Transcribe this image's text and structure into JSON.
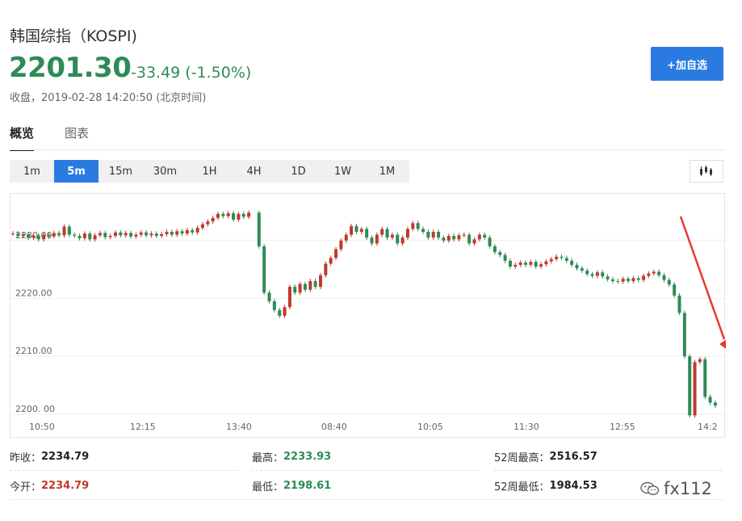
{
  "header": {
    "title": "韩国综指（KOSPI)",
    "price": "2201.30",
    "change": "-33.49 (-1.50%)",
    "status": "收盘，2019-02-28 14:20:50 (北京时间)",
    "add_button": "+加自选"
  },
  "tabs": [
    {
      "label": "概览",
      "active": true
    },
    {
      "label": "图表",
      "active": false
    }
  ],
  "intervals": [
    {
      "label": "1m",
      "active": false
    },
    {
      "label": "5m",
      "active": true
    },
    {
      "label": "15m",
      "active": false
    },
    {
      "label": "30m",
      "active": false
    },
    {
      "label": "1H",
      "active": false
    },
    {
      "label": "4H",
      "active": false
    },
    {
      "label": "1D",
      "active": false
    },
    {
      "label": "1W",
      "active": false
    },
    {
      "label": "1M",
      "active": false
    }
  ],
  "chart_type_icon": "candlestick-icon",
  "colors": {
    "up": "#c0392b",
    "down": "#2e8b57",
    "accent": "#2a7ae2",
    "arrow": "#e53935"
  },
  "chart_data": {
    "type": "candlestick",
    "y_ticks": [
      "2200. 00",
      "2210.00",
      "2220.00",
      "2230.00"
    ],
    "y_tick_values": [
      2200,
      2210,
      2220,
      2230
    ],
    "x_ticks": [
      "10:50",
      "12:15",
      "13:40",
      "08:40",
      "10:05",
      "11:30",
      "12:55",
      "14:2"
    ],
    "ylim": [
      2199,
      2237.5
    ],
    "grid": true,
    "annotation": "red arrow pointing at final drop",
    "sessions": [
      [
        2231.2,
        2230.8,
        2231.1,
        2230.5,
        2230.9,
        2230.2,
        2231.0,
        2230.7,
        2231.3,
        2230.9,
        2232.4,
        2231.0,
        2230.8,
        2230.4,
        2231.2,
        2230.2,
        2230.9,
        2231.3,
        2230.6,
        2230.8,
        2231.4,
        2230.9,
        2231.3,
        2230.7,
        2231.0,
        2231.4,
        2230.9,
        2231.2,
        2230.8,
        2231.1,
        2231.5,
        2231.0,
        2231.6,
        2231.2,
        2231.8,
        2231.4,
        2232.2,
        2232.8,
        2233.3,
        2233.9,
        2234.6,
        2234.2,
        2234.7,
        2233.6,
        2234.6,
        2234.1,
        2234.8
      ],
      [
        2229.0,
        2221.0,
        2219.5,
        2218.0,
        2217.0,
        2218.5,
        2222.0,
        2221.0,
        2222.5,
        2221.5,
        2223.0,
        2222.0,
        2224.0,
        2226.0,
        2227.0,
        2228.5,
        2230.0,
        2231.0,
        2232.5,
        2231.5,
        2232.0,
        2230.5,
        2229.5,
        2231.0,
        2232.0,
        2230.5,
        2231.0,
        2229.5,
        2230.5,
        2232.0,
        2233.0,
        2232.0,
        2231.5,
        2230.5,
        2231.5,
        2230.5,
        2230.0,
        2230.8,
        2230.2,
        2230.9,
        2231.0,
        2229.5,
        2230.2,
        2231.0,
        2230.5,
        2229.0,
        2228.0,
        2227.5,
        2226.5,
        2225.5,
        2225.8,
        2226.2,
        2225.8,
        2226.3,
        2225.5,
        2225.9,
        2226.4,
        2226.8,
        2227.2,
        2227.0,
        2226.5,
        2225.8,
        2225.2,
        2224.8,
        2224.2,
        2223.9,
        2224.5,
        2223.8,
        2223.3,
        2223.0,
        2222.9,
        2223.4,
        2223.0,
        2223.5,
        2223.2,
        2223.9,
        2224.3,
        2224.6,
        2224.0,
        2223.2,
        2222.4,
        2220.5,
        2217.5,
        2210.0,
        2199.8,
        2209.0,
        2209.5,
        2203.0,
        2202.0,
        2201.5
      ]
    ]
  },
  "stats": [
    {
      "label": "昨收：",
      "value": "2234.79",
      "color": ""
    },
    {
      "label": "最高：",
      "value": "2233.93",
      "color": "green"
    },
    {
      "label": "52周最高：",
      "value": "2516.57",
      "color": ""
    },
    {
      "label": "今开：",
      "value": "2234.79",
      "color": "red"
    },
    {
      "label": "最低：",
      "value": "2198.61",
      "color": "green"
    },
    {
      "label": "52周最低：",
      "value": "1984.53",
      "color": ""
    }
  ],
  "watermark": "fx112"
}
